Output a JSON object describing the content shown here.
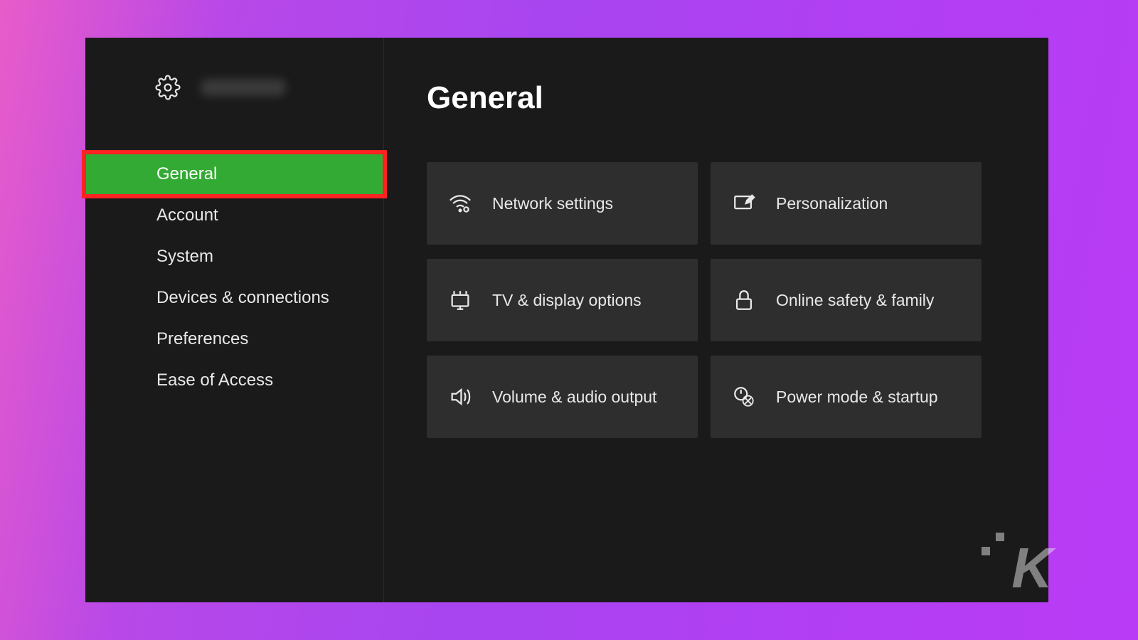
{
  "page_title": "General",
  "sidebar": {
    "items": [
      {
        "label": "General",
        "selected": true
      },
      {
        "label": "Account",
        "selected": false
      },
      {
        "label": "System",
        "selected": false
      },
      {
        "label": "Devices & connections",
        "selected": false
      },
      {
        "label": "Preferences",
        "selected": false
      },
      {
        "label": "Ease of Access",
        "selected": false
      }
    ]
  },
  "tiles": [
    {
      "label": "Network settings",
      "icon": "network-icon"
    },
    {
      "label": "Personalization",
      "icon": "personalization-icon"
    },
    {
      "label": "TV & display options",
      "icon": "display-icon"
    },
    {
      "label": "Online safety & family",
      "icon": "lock-icon"
    },
    {
      "label": "Volume & audio output",
      "icon": "volume-icon"
    },
    {
      "label": "Power mode & startup",
      "icon": "power-icon"
    }
  ],
  "colors": {
    "accent": "#33aa33",
    "highlight_border": "#ff2222",
    "background": "#1a1a1a",
    "tile": "#2e2e2e"
  }
}
